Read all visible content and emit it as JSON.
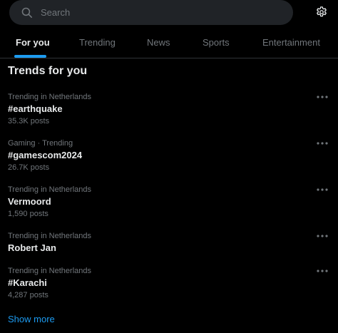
{
  "search": {
    "placeholder": "Search",
    "icon": "search-icon"
  },
  "settings": {
    "icon": "gear-icon"
  },
  "tabs": [
    {
      "label": "For you",
      "active": true
    },
    {
      "label": "Trending",
      "active": false
    },
    {
      "label": "News",
      "active": false
    },
    {
      "label": "Sports",
      "active": false
    },
    {
      "label": "Entertainment",
      "active": false
    }
  ],
  "section": {
    "title": "Trends for you"
  },
  "trends": [
    {
      "context": "Trending in Netherlands",
      "name": "#earthquake",
      "posts": "35.3K posts"
    },
    {
      "context": "Gaming · Trending",
      "name": "#gamescom2024",
      "posts": "26.7K posts"
    },
    {
      "context": "Trending in Netherlands",
      "name": "Vermoord",
      "posts": "1,590 posts"
    },
    {
      "context": "Trending in Netherlands",
      "name": "Robert Jan",
      "posts": ""
    },
    {
      "context": "Trending in Netherlands",
      "name": "#Karachi",
      "posts": "4,287 posts"
    }
  ],
  "show_more": {
    "label": "Show more"
  },
  "colors": {
    "background": "#000000",
    "accent": "#1d9bf0",
    "primary_text": "#e7e9ea",
    "secondary_text": "#71767b",
    "search_bg": "#202327",
    "divider": "#2f3336"
  }
}
